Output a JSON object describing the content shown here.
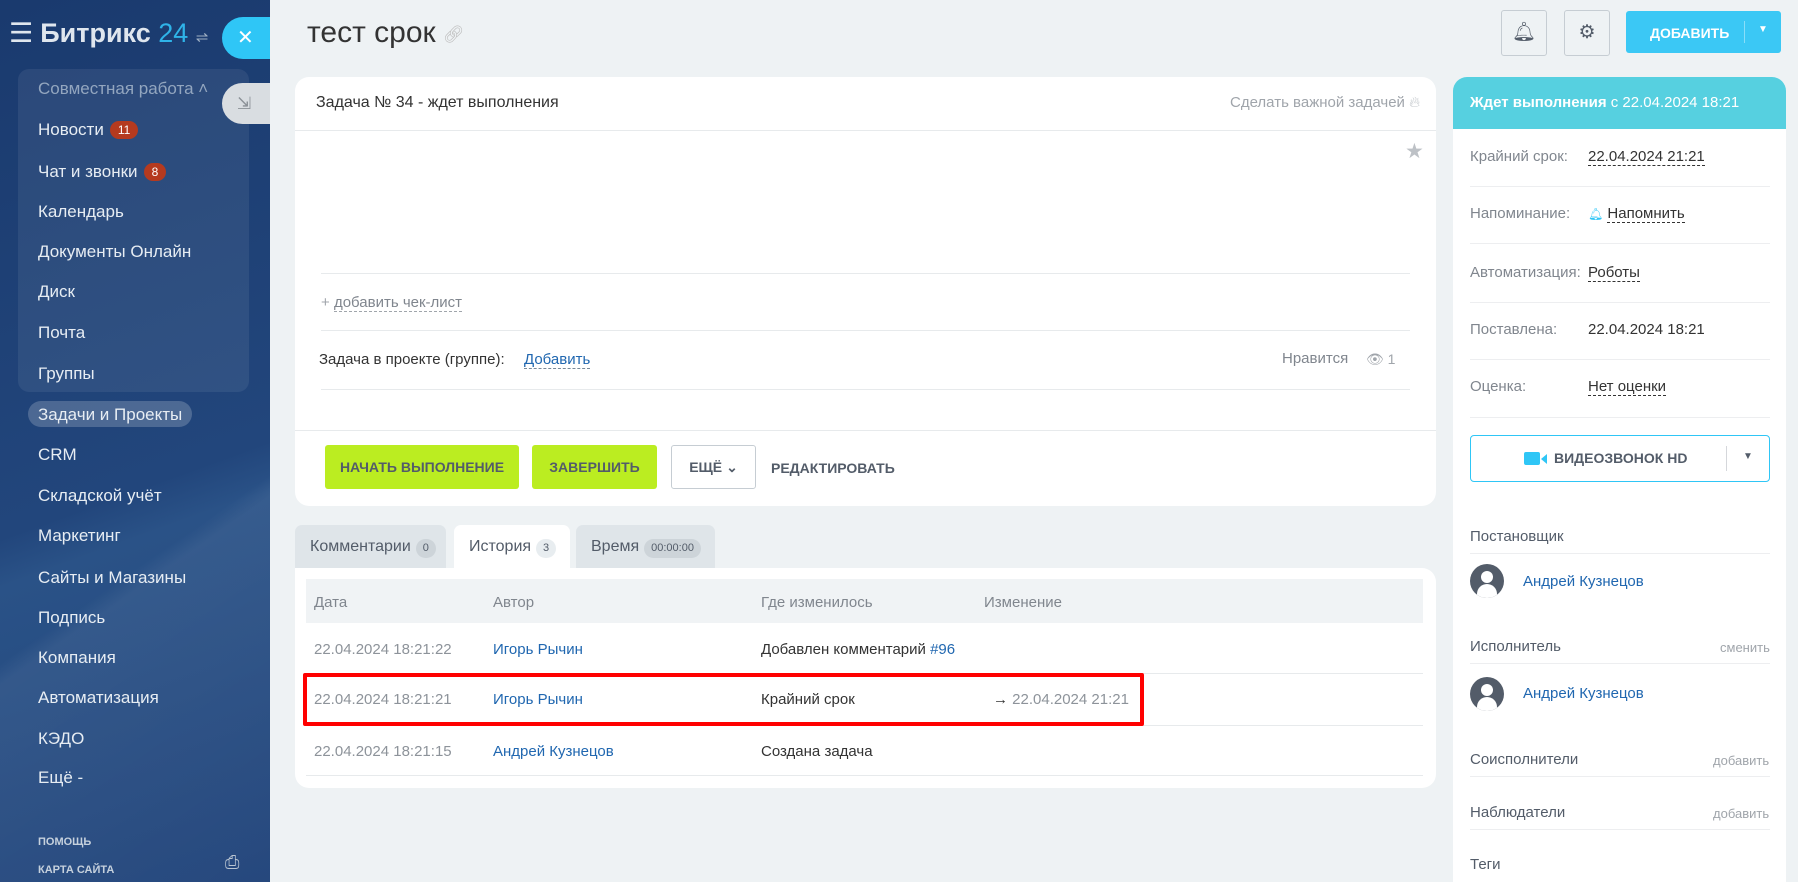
{
  "sidebar": {
    "logo_text": "Битрикс",
    "logo_num": "24",
    "group_header": "Совместная работа",
    "items": [
      {
        "label": "Новости",
        "badge": "11"
      },
      {
        "label": "Чат и звонки",
        "badge": "8"
      },
      {
        "label": "Календарь"
      },
      {
        "label": "Документы Онлайн"
      },
      {
        "label": "Диск"
      },
      {
        "label": "Почта"
      },
      {
        "label": "Группы"
      },
      {
        "label": "Задачи и Проекты",
        "active": true
      },
      {
        "label": "CRM"
      },
      {
        "label": "Складской учёт"
      },
      {
        "label": "Маркетинг"
      },
      {
        "label": "Сайты и Магазины"
      },
      {
        "label": "Подпись"
      },
      {
        "label": "Компания"
      },
      {
        "label": "Автоматизация"
      },
      {
        "label": "КЭДО"
      },
      {
        "label": "Ещё -"
      }
    ],
    "help": "ПОМОЩЬ",
    "sitemap": "КАРТА САЙТА"
  },
  "header": {
    "title": "тест срок",
    "add_label": "ДОБАВИТЬ"
  },
  "task": {
    "heading": "Задача № 34 - ждет выполнения",
    "make_important": "Сделать важной задачей",
    "add_checklist": "добавить чек-лист",
    "project_label": "Задача в проекте (группе):",
    "project_add": "Добавить",
    "like": "Нравится",
    "views": "1",
    "buttons": {
      "start": "НАЧАТЬ ВЫПОЛНЕНИЕ",
      "finish": "ЗАВЕРШИТЬ",
      "more": "ЕЩЁ",
      "edit": "РЕДАКТИРОВАТЬ"
    }
  },
  "tabs": [
    {
      "label": "Комментарии",
      "count": "0"
    },
    {
      "label": "История",
      "count": "3",
      "active": true
    },
    {
      "label": "Время",
      "count": "00:00:00"
    }
  ],
  "history": {
    "columns": [
      "Дата",
      "Автор",
      "Где изменилось",
      "Изменение"
    ],
    "rows": [
      {
        "date": "22.04.2024 18:21:22",
        "author": "Игорь Рычин",
        "where": "Добавлен комментарий",
        "where_link": "#96",
        "change": ""
      },
      {
        "date": "22.04.2024 18:21:21",
        "author": "Игорь Рычин",
        "where": "Крайний срок",
        "where_link": "",
        "change": "22.04.2024 21:21",
        "highlighted": true
      },
      {
        "date": "22.04.2024 18:21:15",
        "author": "Андрей Кузнецов",
        "where": "Создана задача",
        "where_link": "",
        "change": ""
      }
    ]
  },
  "right_panel": {
    "status_bold": "Ждет выполнения",
    "status_rest": "с 22.04.2024 18:21",
    "status_color": "#56d0e0",
    "fields": [
      {
        "label": "Крайний срок:",
        "value": "22.04.2024 21:21"
      },
      {
        "label": "Напоминание:",
        "value": "Напомнить"
      },
      {
        "label": "Автоматизация:",
        "value": "Роботы"
      },
      {
        "label": "Поставлена:",
        "value": "22.04.2024 18:21"
      },
      {
        "label": "Оценка:",
        "value": "Нет оценки"
      }
    ],
    "video_call": "ВИДЕОЗВОНОК HD",
    "creator_label": "Постановщик",
    "creator": "Андрей Кузнецов",
    "responsible_label": "Исполнитель",
    "responsible_action": "сменить",
    "responsible": "Андрей Кузнецов",
    "accomplices_label": "Соисполнители",
    "accomplices_action": "добавить",
    "auditors_label": "Наблюдатели",
    "auditors_action": "добавить",
    "tags_label": "Теги"
  }
}
